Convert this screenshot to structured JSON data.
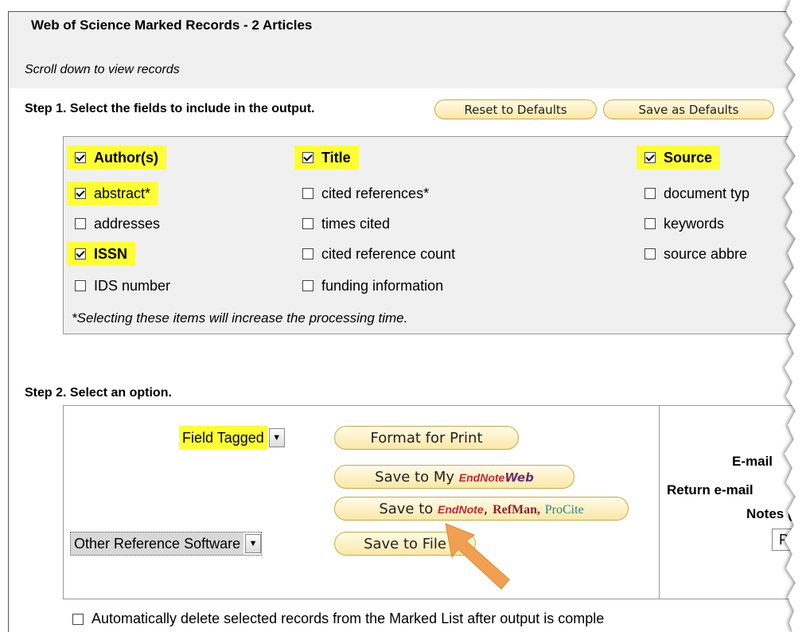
{
  "header": {
    "title": "Web of Science Marked Records - 2 Articles",
    "scroll_note": "Scroll down to view records"
  },
  "step1": {
    "label": "Step 1. Select the fields to include in the output.",
    "reset_label": "Reset to Defaults",
    "save_defaults_label": "Save as Defaults",
    "fields": {
      "authors": {
        "label": "Author(s)",
        "checked": true
      },
      "abstract": {
        "label": "abstract*",
        "checked": true
      },
      "addresses": {
        "label": "addresses",
        "checked": false
      },
      "issn": {
        "label": "ISSN",
        "checked": true
      },
      "ids_number": {
        "label": "IDS number",
        "checked": false
      },
      "title": {
        "label": "Title",
        "checked": true
      },
      "cited_references": {
        "label": "cited references*",
        "checked": false
      },
      "times_cited": {
        "label": "times cited",
        "checked": false
      },
      "cited_reference_count": {
        "label": "cited reference count",
        "checked": false
      },
      "funding_information": {
        "label": "funding information",
        "checked": false
      },
      "source": {
        "label": "Source",
        "checked": true
      },
      "document_type": {
        "label": "document typ",
        "checked": false
      },
      "keywords": {
        "label": "keywords",
        "checked": false
      },
      "source_abbrev": {
        "label": "source abbre",
        "checked": false
      }
    },
    "processing_note": "*Selecting these items will increase the processing time."
  },
  "step2": {
    "label": "Step 2. Select an option.",
    "format_select_value": "Field Tagged",
    "format_for_print_label": "Format for Print",
    "save_to_my_label": "Save to My",
    "endnote_label": "EndNote",
    "web_label": "Web",
    "save_to_label": "Save to",
    "refman_label": "RefMan,",
    "procite_label": "ProCite",
    "software_select_value": "Other Reference Software",
    "save_to_file_label": "Save to File",
    "email_label": "E-mail",
    "return_email_label": "Return e-mail",
    "notes_label": "Notes (",
    "notes_placeholder": "Pl"
  },
  "auto_delete": {
    "label": "Automatically delete selected records from the Marked List after output is comple",
    "checked": false
  },
  "colors": {
    "highlight": "#ffff33",
    "pill_button": "#fbe7a5",
    "panel_bg": "#f0f0f0",
    "arrow": "#f0a050"
  }
}
